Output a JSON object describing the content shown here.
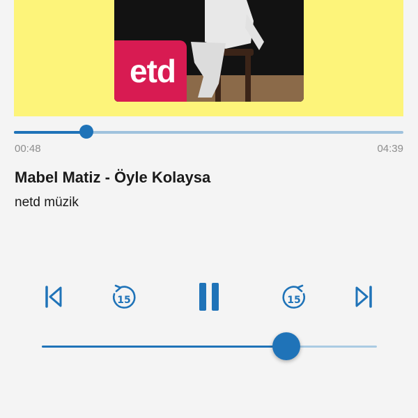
{
  "artwork": {
    "background_color": "#fdf47a",
    "logo_text": "etd",
    "logo_color": "#d81b52"
  },
  "playback": {
    "elapsed": "00:48",
    "total": "04:39",
    "progress_fraction": 0.186
  },
  "track": {
    "title": "Mabel Matiz - Öyle Kolaysa",
    "artist": "netd müzik"
  },
  "controls": {
    "previous_icon": "skip-previous-icon",
    "rewind_icon": "rewind-15-icon",
    "rewind_seconds": "15",
    "pause_icon": "pause-icon",
    "forward_icon": "forward-15-icon",
    "forward_seconds": "15",
    "next_icon": "skip-next-icon"
  },
  "volume": {
    "level_fraction": 0.73
  },
  "colors": {
    "accent": "#1f73b8",
    "track": "#9fc2dd",
    "background": "#f4f4f4",
    "text": "#1a1a1a",
    "muted_text": "#8d8d8d"
  }
}
